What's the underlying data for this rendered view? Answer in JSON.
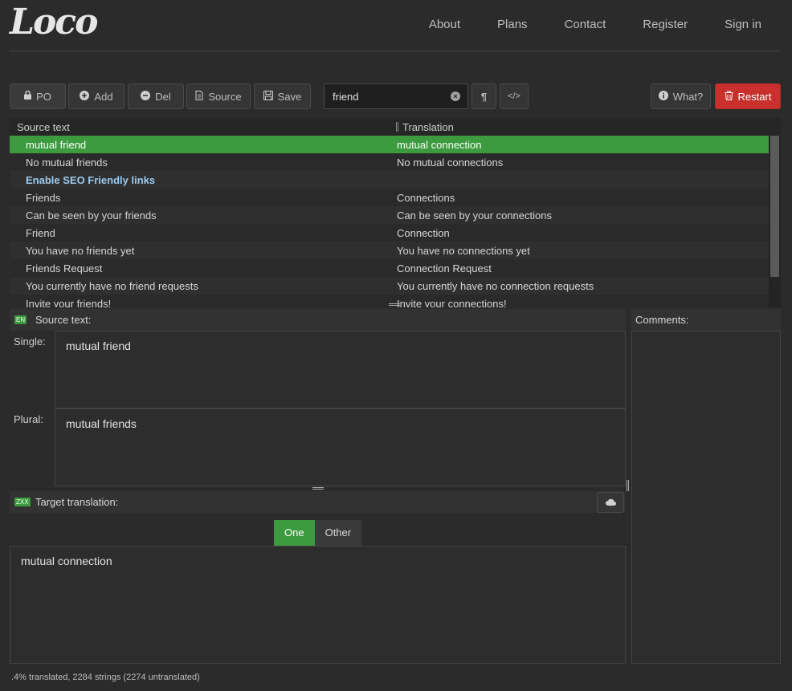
{
  "header": {
    "logo": "Loco",
    "nav": [
      "About",
      "Plans",
      "Contact",
      "Register",
      "Sign in"
    ]
  },
  "toolbar": {
    "po": "PO",
    "add": "Add",
    "del": "Del",
    "source": "Source",
    "save": "Save",
    "search_value": "friend",
    "pilcrow": "¶",
    "code": "</>",
    "what": "What?",
    "restart": "Restart"
  },
  "table": {
    "col_source": "Source text",
    "col_translation": "Translation",
    "rows": [
      {
        "source": "mutual friend",
        "translation": "mutual connection"
      },
      {
        "source": "No mutual friends",
        "translation": "No mutual connections"
      },
      {
        "source": "Enable SEO Friendly links",
        "translation": ""
      },
      {
        "source": "Friends",
        "translation": "Connections"
      },
      {
        "source": "Can be seen by your friends",
        "translation": "Can be seen by your connections"
      },
      {
        "source": "Friend",
        "translation": "Connection"
      },
      {
        "source": "You have no friends yet",
        "translation": "You have no connections yet"
      },
      {
        "source": "Friends Request",
        "translation": "Connection Request"
      },
      {
        "source": "You currently have no friend requests",
        "translation": "You currently have no connection requests"
      },
      {
        "source": "Invite your friends!",
        "translation": "Invite your connections!"
      }
    ]
  },
  "source_panel": {
    "lang": "EN",
    "title": "Source text:",
    "single_label": "Single:",
    "single_value": "mutual friend",
    "plural_label": "Plural:",
    "plural_value": "mutual friends"
  },
  "target_panel": {
    "lang": "ZXX",
    "title": "Target translation:",
    "tabs": [
      "One",
      "Other"
    ],
    "value": "mutual connection"
  },
  "comments": {
    "title": "Comments:"
  },
  "status": ".4% translated, 2284 strings (2274 untranslated)",
  "colors": {
    "accent_green": "#3c9b3e",
    "danger_red": "#c9302c",
    "untranslated_blue": "#9ccbf0"
  }
}
